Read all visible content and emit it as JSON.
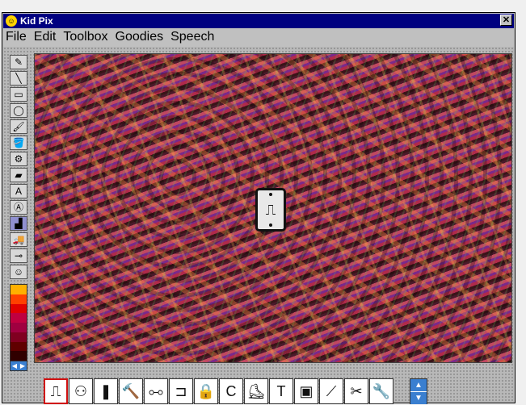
{
  "window": {
    "title": "Kid Pix",
    "close_glyph": "✕"
  },
  "menu": [
    "File",
    "Edit",
    "Toolbox",
    "Goodies",
    "Speech"
  ],
  "toolbox": {
    "tools": [
      {
        "name": "pencil-tool",
        "glyph": "✎"
      },
      {
        "name": "line-tool",
        "glyph": "╲"
      },
      {
        "name": "rectangle-tool",
        "glyph": "▭"
      },
      {
        "name": "oval-tool",
        "glyph": "◯"
      },
      {
        "name": "wacky-brush-tool",
        "glyph": "🖌"
      },
      {
        "name": "paint-can-tool",
        "glyph": "🪣"
      },
      {
        "name": "electric-mixer-tool",
        "glyph": "⚙"
      },
      {
        "name": "eraser-tool",
        "glyph": "▰"
      },
      {
        "name": "text-tool",
        "glyph": "A"
      },
      {
        "name": "alphabet-stamp-tool",
        "glyph": "Ⓐ"
      },
      {
        "name": "rubber-stamp-tool",
        "glyph": "▟",
        "selected": true
      },
      {
        "name": "moving-van-tool",
        "glyph": "🚚"
      },
      {
        "name": "eyedropper-tool",
        "glyph": "⊸"
      },
      {
        "name": "undo-guy-tool",
        "glyph": "☺"
      }
    ],
    "palette_colors": [
      "#ffb000",
      "#ff4000",
      "#e00000",
      "#c00040",
      "#a00040",
      "#800020",
      "#600000",
      "#300000"
    ],
    "palette_arrows": [
      "◀",
      "▶"
    ]
  },
  "stamps": {
    "items": [
      {
        "name": "light-switch-stamp",
        "glyph": "⎍",
        "selected": true
      },
      {
        "name": "outlet-stamp",
        "glyph": "⚇"
      },
      {
        "name": "toothpaste-stamp",
        "glyph": "❚"
      },
      {
        "name": "hammer-stamp",
        "glyph": "🔨"
      },
      {
        "name": "dumbbell-stamp",
        "glyph": "⧟"
      },
      {
        "name": "stapler-stamp",
        "glyph": "⊐"
      },
      {
        "name": "padlock-stamp",
        "glyph": "🔒"
      },
      {
        "name": "c-clamp-stamp",
        "glyph": "C"
      },
      {
        "name": "roller-skate-stamp",
        "glyph": "⛸"
      },
      {
        "name": "mallet-stamp",
        "glyph": "T"
      },
      {
        "name": "label-maker-stamp",
        "glyph": "▣"
      },
      {
        "name": "screwdriver-stamp",
        "glyph": "⟋"
      },
      {
        "name": "scissors-stamp",
        "glyph": "✂"
      },
      {
        "name": "wrench-stamp",
        "glyph": "🔧"
      }
    ],
    "scroll_arrows": [
      "▲",
      "▼"
    ]
  },
  "canvas": {
    "cursor_stamp_glyph": "⎍"
  }
}
